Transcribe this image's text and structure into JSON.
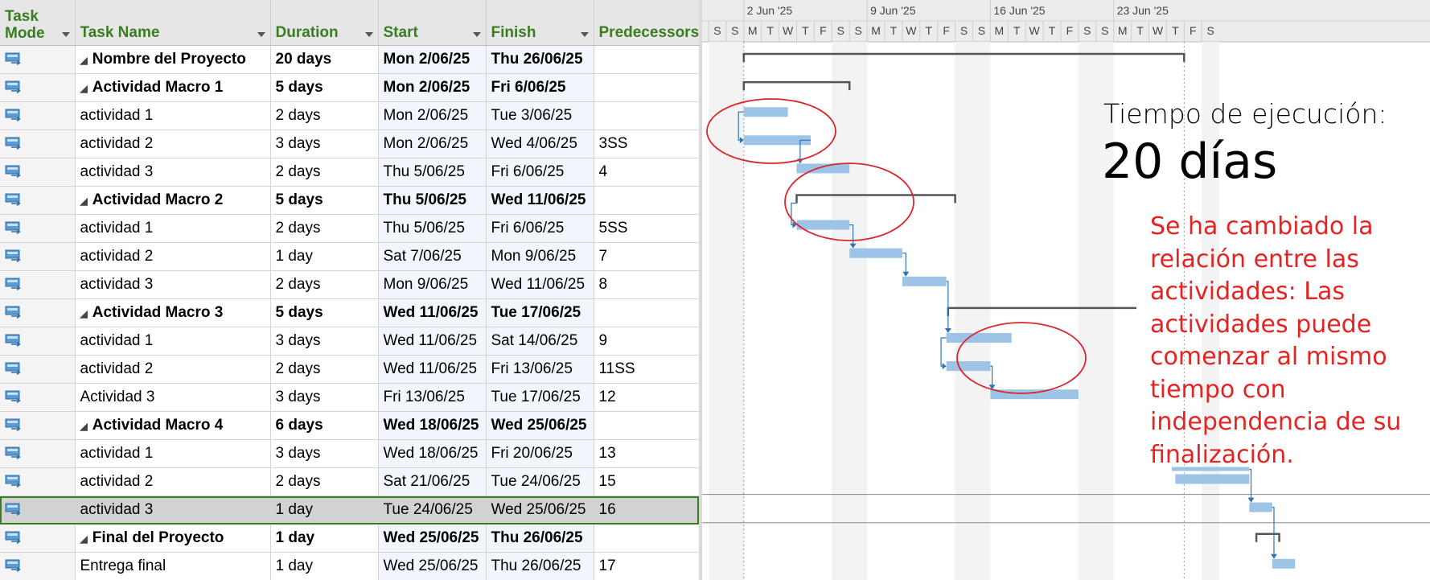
{
  "columns": {
    "mode_line1": "Task",
    "mode_line2": "Mode",
    "name": "Task Name",
    "duration": "Duration",
    "start": "Start",
    "finish": "Finish",
    "predecessors": "Predecessors"
  },
  "timescale": {
    "weeks": [
      "2 Jun '25",
      "9 Jun '25",
      "16 Jun '25",
      "23 Jun '25"
    ],
    "days": [
      "S",
      "S",
      "M",
      "T",
      "W",
      "T",
      "F",
      "S",
      "S",
      "M",
      "T",
      "W",
      "T",
      "F",
      "S",
      "S",
      "M",
      "T",
      "W",
      "T",
      "F",
      "S",
      "S",
      "M",
      "T",
      "W",
      "T",
      "F",
      "S"
    ]
  },
  "tasks": [
    {
      "name": "Nombre del Proyecto",
      "level": 0,
      "summary": true,
      "duration": "20 days",
      "start": "Mon 2/06/25",
      "finish": "Thu 26/06/25",
      "pred": ""
    },
    {
      "name": "Actividad Macro 1",
      "level": 1,
      "summary": true,
      "duration": "5 days",
      "start": "Mon 2/06/25",
      "finish": "Fri 6/06/25",
      "pred": ""
    },
    {
      "name": "actividad 1",
      "level": 2,
      "summary": false,
      "duration": "2 days",
      "start": "Mon 2/06/25",
      "finish": "Tue 3/06/25",
      "pred": ""
    },
    {
      "name": "actividad 2",
      "level": 2,
      "summary": false,
      "duration": "3 days",
      "start": "Mon 2/06/25",
      "finish": "Wed 4/06/25",
      "pred": "3SS"
    },
    {
      "name": "actividad 3",
      "level": 2,
      "summary": false,
      "duration": "2 days",
      "start": "Thu 5/06/25",
      "finish": "Fri 6/06/25",
      "pred": "4"
    },
    {
      "name": "Actividad Macro 2",
      "level": 1,
      "summary": true,
      "duration": "5 days",
      "start": "Thu 5/06/25",
      "finish": "Wed 11/06/25",
      "pred": ""
    },
    {
      "name": "actividad 1",
      "level": 2,
      "summary": false,
      "duration": "2 days",
      "start": "Thu 5/06/25",
      "finish": "Fri 6/06/25",
      "pred": "5SS"
    },
    {
      "name": "actividad 2",
      "level": 2,
      "summary": false,
      "duration": "1 day",
      "start": "Sat 7/06/25",
      "finish": "Mon 9/06/25",
      "pred": "7"
    },
    {
      "name": "actividad 3",
      "level": 2,
      "summary": false,
      "duration": "2 days",
      "start": "Mon 9/06/25",
      "finish": "Wed 11/06/25",
      "pred": "8"
    },
    {
      "name": "Actividad Macro 3",
      "level": 1,
      "summary": true,
      "duration": "5 days",
      "start": "Wed 11/06/25",
      "finish": "Tue 17/06/25",
      "pred": ""
    },
    {
      "name": "actividad 1",
      "level": 2,
      "summary": false,
      "duration": "3 days",
      "start": "Wed 11/06/25",
      "finish": "Sat 14/06/25",
      "pred": "9"
    },
    {
      "name": "actividad 2",
      "level": 2,
      "summary": false,
      "duration": "2 days",
      "start": "Wed 11/06/25",
      "finish": "Fri 13/06/25",
      "pred": "11SS"
    },
    {
      "name": "Actividad 3",
      "level": 2,
      "summary": false,
      "duration": "3 days",
      "start": "Fri 13/06/25",
      "finish": "Tue 17/06/25",
      "pred": "12"
    },
    {
      "name": "Actividad Macro 4",
      "level": 1,
      "summary": true,
      "duration": "6 days",
      "start": "Wed 18/06/25",
      "finish": "Wed 25/06/25",
      "pred": ""
    },
    {
      "name": "actividad 1",
      "level": 2,
      "summary": false,
      "duration": "3 days",
      "start": "Wed 18/06/25",
      "finish": "Fri 20/06/25",
      "pred": "13"
    },
    {
      "name": "actividad 2",
      "level": 2,
      "summary": false,
      "duration": "2 days",
      "start": "Sat 21/06/25",
      "finish": "Tue 24/06/25",
      "pred": "15"
    },
    {
      "name": "actividad 3",
      "level": 2,
      "summary": false,
      "duration": "1 day",
      "start": "Tue 24/06/25",
      "finish": "Wed 25/06/25",
      "pred": "16",
      "selected": true
    },
    {
      "name": "Final del Proyecto",
      "level": 1,
      "summary": true,
      "duration": "1 day",
      "start": "Wed 25/06/25",
      "finish": "Thu 26/06/25",
      "pred": ""
    },
    {
      "name": "Entrega final",
      "level": 2,
      "summary": false,
      "duration": "1 day",
      "start": "Wed 25/06/25",
      "finish": "Thu 26/06/25",
      "pred": "17"
    }
  ],
  "annotations": {
    "time_label": "Tiempo de ejecución:",
    "time_value": "20 días",
    "note": "Se ha cambiado la relación entre las actividades: Las actividades puede comenzar al mismo tiempo con independencia de su finalización."
  },
  "colors": {
    "header_text": "#3a7d22",
    "task_bar": "#9dc3e6",
    "summary_bar": "#555555",
    "link": "#2e75b6",
    "circle": "#d9272e",
    "note_text": "#e32422"
  }
}
